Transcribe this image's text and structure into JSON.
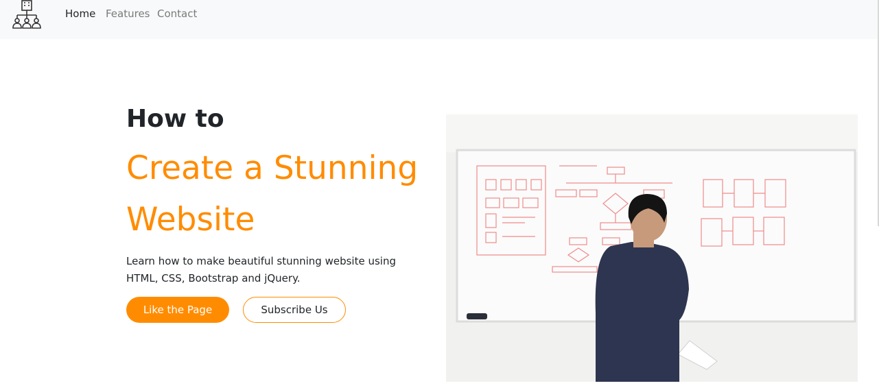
{
  "nav": {
    "logo_icon": "org-chart-building-icon",
    "links": [
      "Home",
      "Features",
      "Contact"
    ]
  },
  "hero": {
    "heading_small": "How to",
    "heading_big": "Create a Stunning Website",
    "lead": "Learn how to make beautiful stunning website using HTML, CSS, Bootstrap and jQuery.",
    "primary_button": "Like the Page",
    "secondary_button": "Subscribe Us",
    "image_icon": "man-at-whiteboard-photo"
  },
  "colors": {
    "accent": "#ff8c00",
    "navbar_bg": "#f8f9fa",
    "text": "#212529"
  }
}
